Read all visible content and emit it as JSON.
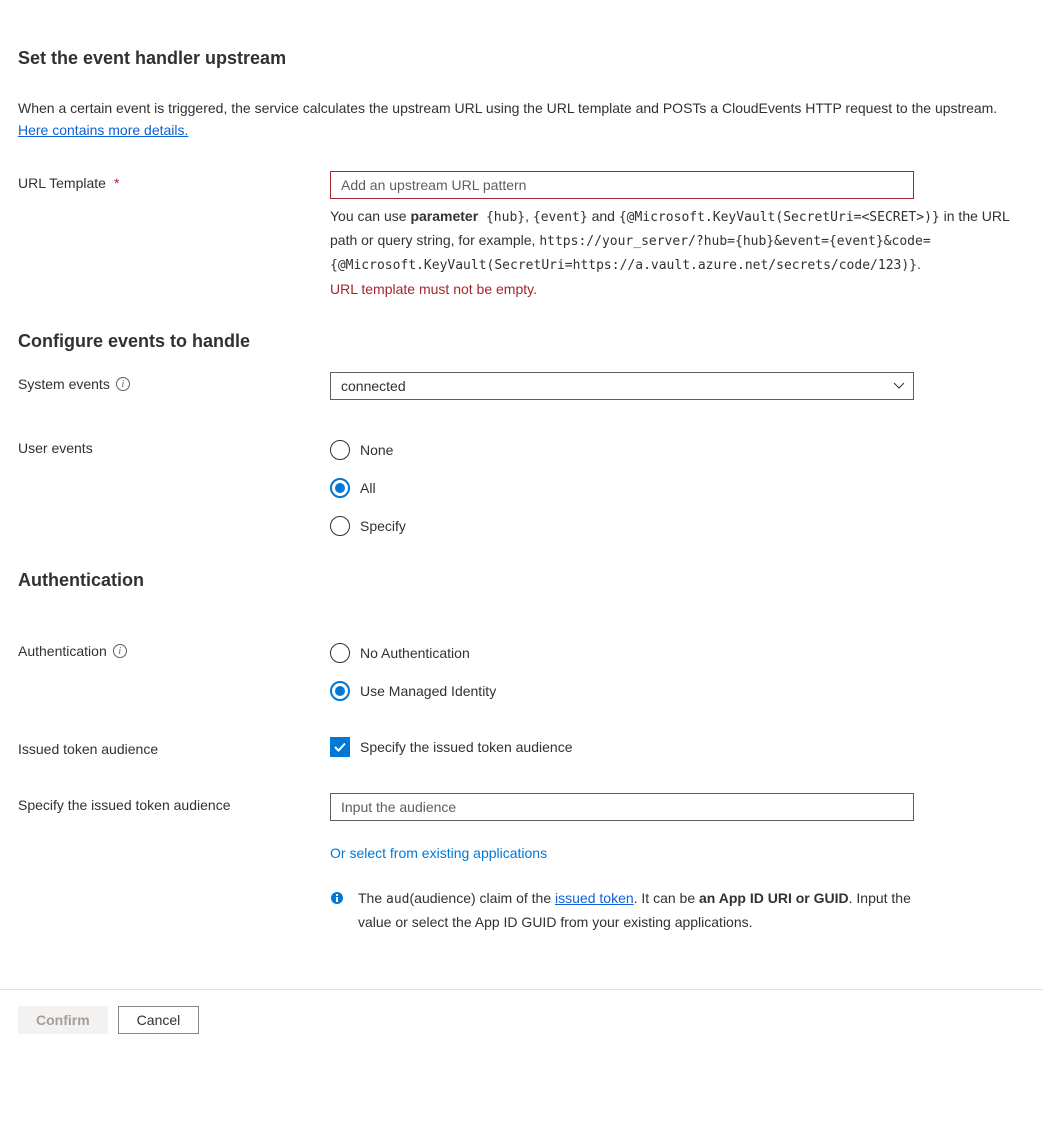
{
  "headings": {
    "title": "Set the event handler upstream",
    "events": "Configure events to handle",
    "auth": "Authentication"
  },
  "intro": {
    "text1": "When a certain event is triggered, the service calculates the upstream URL using the URL template and POSTs a CloudEvents HTTP request to the upstream. ",
    "link": "Here contains more details."
  },
  "urlTemplate": {
    "label": "URL Template",
    "required": "*",
    "placeholder": "Add an upstream URL pattern",
    "help_pre": "You can use ",
    "help_bold": "parameter",
    "help_code1": " {hub}",
    "help_mid1": ", ",
    "help_code2": "{event}",
    "help_mid2": " and ",
    "help_code3": "{@Microsoft.KeyVault(SecretUri=<SECRET>)}",
    "help_mid3": " in the URL path or query string, for example, ",
    "help_code4": "https://your_server/?hub={hub}&event={event}&code={@Microsoft.KeyVault(SecretUri=https://a.vault.azure.net/secrets/code/123)}",
    "help_end": ".",
    "error": "URL template must not be empty."
  },
  "systemEvents": {
    "label": "System events",
    "value": "connected"
  },
  "userEvents": {
    "label": "User events",
    "options": {
      "none": "None",
      "all": "All",
      "specify": "Specify"
    }
  },
  "auth": {
    "label": "Authentication",
    "options": {
      "none": "No Authentication",
      "managed": "Use Managed Identity"
    }
  },
  "issuedToken": {
    "label": "Issued token audience",
    "checkbox": "Specify the issued token audience"
  },
  "audienceInput": {
    "label": "Specify the issued token audience",
    "placeholder": "Input the audience",
    "linkAction": "Or select from existing applications",
    "note_pre": "The ",
    "note_code": "aud",
    "note_mid1": "(audience) claim of the ",
    "note_link": "issued token",
    "note_mid2": ". It can be ",
    "note_bold": "an App ID URI or GUID",
    "note_end": ". Input the value or select the App ID GUID from your existing applications."
  },
  "buttons": {
    "confirm": "Confirm",
    "cancel": "Cancel"
  }
}
